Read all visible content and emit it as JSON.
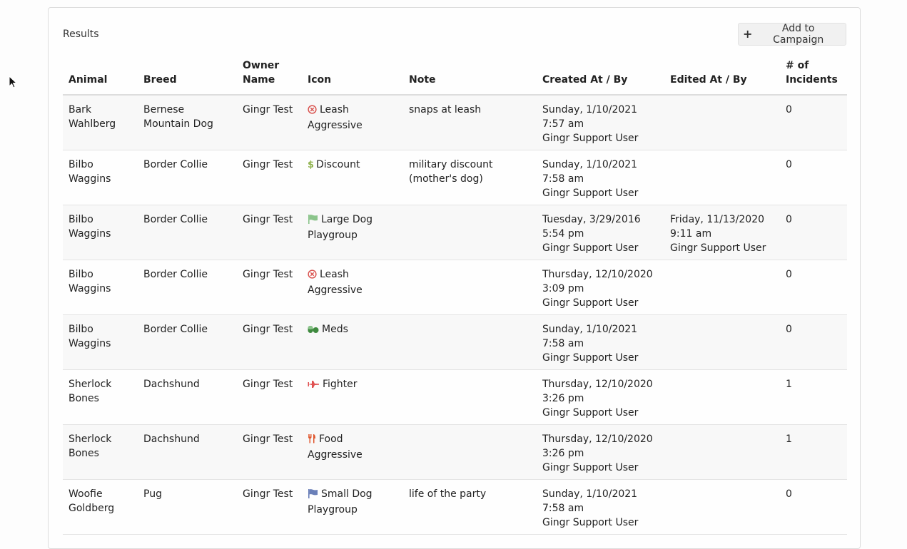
{
  "results_title": "Results",
  "add_button_label": "Add to Campaign",
  "columns": [
    "Animal",
    "Breed",
    "Owner Name",
    "Icon",
    "Note",
    "Created At / By",
    "Edited At / By",
    "# of Incidents"
  ],
  "icon_colors": {
    "x-circle": "#d9534f",
    "dollar": "#8fb24d",
    "flag-green": "#8bc48b",
    "pills": "#3f8a3f",
    "plane": "#e05252",
    "utensils": "#e0562d",
    "flag-blue": "#6a7fb8"
  },
  "rows": [
    {
      "animal": "Bark Wahlberg",
      "breed": "Bernese Mountain Dog",
      "owner": "Gingr Test",
      "icon": "x-circle",
      "icon_label": "Leash Aggressive",
      "note": "snaps at leash",
      "created": "Sunday, 1/10/2021 7:57 am",
      "created_by": "Gingr Support User",
      "edited": "",
      "edited_by": "",
      "incidents": "0"
    },
    {
      "animal": "Bilbo Waggins",
      "breed": "Border Collie",
      "owner": "Gingr Test",
      "icon": "dollar",
      "icon_label": "Discount",
      "note": "military discount (mother's dog)",
      "created": "Sunday, 1/10/2021 7:58 am",
      "created_by": "Gingr Support User",
      "edited": "",
      "edited_by": "",
      "incidents": "0"
    },
    {
      "animal": "Bilbo Waggins",
      "breed": "Border Collie",
      "owner": "Gingr Test",
      "icon": "flag-green",
      "icon_label": "Large Dog Playgroup",
      "note": "",
      "created": "Tuesday, 3/29/2016 5:54 pm",
      "created_by": "Gingr Support User",
      "edited": "Friday, 11/13/2020 9:11 am",
      "edited_by": "Gingr Support User",
      "incidents": "0"
    },
    {
      "animal": "Bilbo Waggins",
      "breed": "Border Collie",
      "owner": "Gingr Test",
      "icon": "x-circle",
      "icon_label": "Leash Aggressive",
      "note": "",
      "created": "Thursday, 12/10/2020 3:09 pm",
      "created_by": "Gingr Support User",
      "edited": "",
      "edited_by": "",
      "incidents": "0"
    },
    {
      "animal": "Bilbo Waggins",
      "breed": "Border Collie",
      "owner": "Gingr Test",
      "icon": "pills",
      "icon_label": "Meds",
      "note": "",
      "created": "Sunday, 1/10/2021 7:58 am",
      "created_by": "Gingr Support User",
      "edited": "",
      "edited_by": "",
      "incidents": "0"
    },
    {
      "animal": "Sherlock Bones",
      "breed": "Dachshund",
      "owner": "Gingr Test",
      "icon": "plane",
      "icon_label": "Fighter",
      "note": "",
      "created": "Thursday, 12/10/2020 3:26 pm",
      "created_by": "Gingr Support User",
      "edited": "",
      "edited_by": "",
      "incidents": "1"
    },
    {
      "animal": "Sherlock Bones",
      "breed": "Dachshund",
      "owner": "Gingr Test",
      "icon": "utensils",
      "icon_label": "Food Aggressive",
      "note": "",
      "created": "Thursday, 12/10/2020 3:26 pm",
      "created_by": "Gingr Support User",
      "edited": "",
      "edited_by": "",
      "incidents": "1"
    },
    {
      "animal": "Woofie Goldberg",
      "breed": "Pug",
      "owner": "Gingr Test",
      "icon": "flag-blue",
      "icon_label": "Small Dog Playgroup",
      "note": "life of the party",
      "created": "Sunday, 1/10/2021 7:58 am",
      "created_by": "Gingr Support User",
      "edited": "",
      "edited_by": "",
      "incidents": "0"
    }
  ]
}
